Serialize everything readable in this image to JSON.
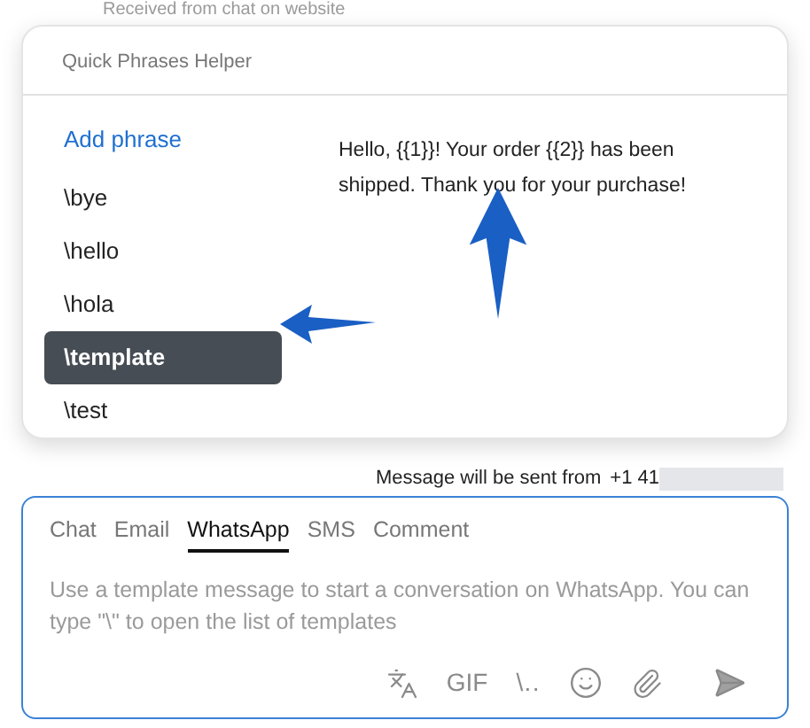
{
  "background_text": "Received from chat on website",
  "popup": {
    "title": "Quick Phrases Helper",
    "add_phrase": "Add phrase",
    "phrases": [
      {
        "label": "\\bye",
        "selected": false
      },
      {
        "label": "\\hello",
        "selected": false
      },
      {
        "label": "\\hola",
        "selected": false
      },
      {
        "label": "\\template",
        "selected": true
      },
      {
        "label": "\\test",
        "selected": false
      }
    ],
    "preview": "Hello, {{1}}! Your order {{2}} has been shipped. Thank you for your purchase!"
  },
  "sender_note": {
    "label": "Message will be sent from",
    "number": "+1 41"
  },
  "composer": {
    "tabs": [
      {
        "label": "Chat",
        "selected": false
      },
      {
        "label": "Email",
        "selected": false
      },
      {
        "label": "WhatsApp",
        "selected": true
      },
      {
        "label": "SMS",
        "selected": false
      },
      {
        "label": "Comment",
        "selected": false
      }
    ],
    "placeholder": "Use a template message to start a conversation on WhatsApp. You can type \"\\\" to open the list of templates",
    "toolbar": [
      {
        "kind": "translate"
      },
      {
        "kind": "gif",
        "label": "GIF"
      },
      {
        "kind": "phrases",
        "label": "\\.."
      },
      {
        "kind": "emoji"
      },
      {
        "kind": "attach"
      },
      {
        "kind": "send"
      }
    ]
  }
}
